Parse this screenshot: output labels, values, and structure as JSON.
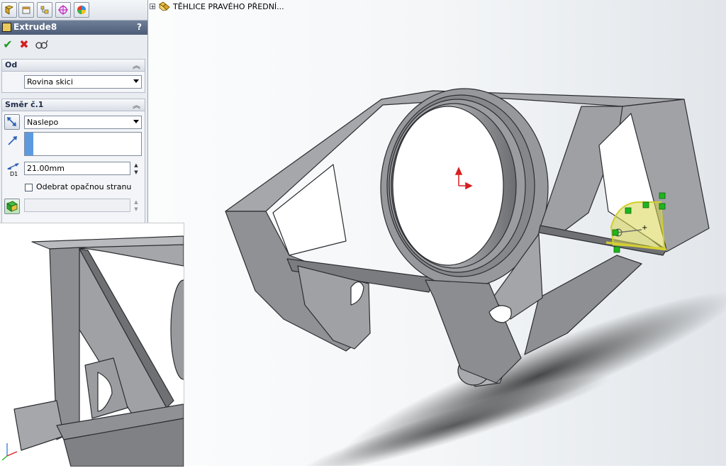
{
  "panel": {
    "title": "Extrude8",
    "help": "?",
    "tabs": [
      "feature-manager-icon",
      "property-manager-icon",
      "configuration-manager-icon",
      "dimxpert-icon",
      "display-manager-icon"
    ],
    "actions": [
      "ok-icon",
      "cancel-icon",
      "detailed-preview-icon"
    ],
    "from_section": {
      "title": "Od",
      "selected": "Rovina skici"
    },
    "direction_section": {
      "title": "Směr č.1",
      "end_condition": "Naslepo",
      "depth": "21.00mm",
      "depth_icon_label": "D1",
      "flip_side_label": "Odebrat opačnou stranu"
    }
  },
  "tree": {
    "expander": "+",
    "item_label": "TĚHLICE PRAVÉHO PŘEDNÍ..."
  },
  "colors": {
    "accent": "#5c9ae0",
    "model_gray": "#8d8f93",
    "sketch_yellow": "#d8d84a",
    "sketch_green": "#1fb51f",
    "axis_red": "#d62020"
  }
}
